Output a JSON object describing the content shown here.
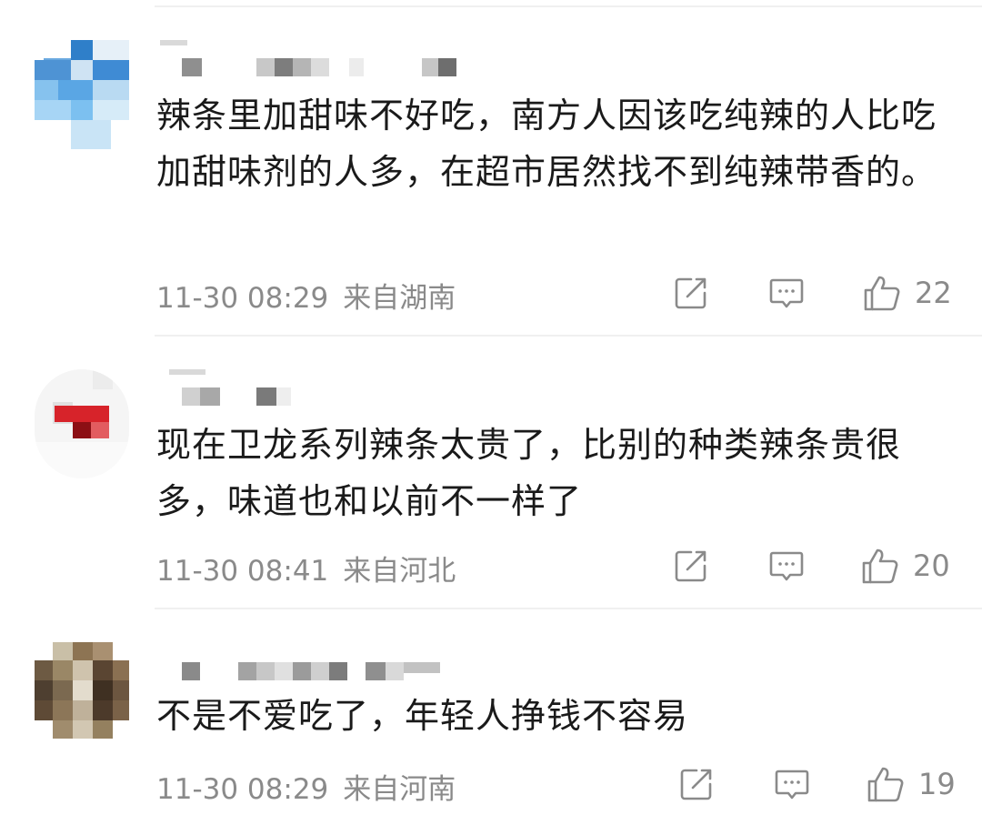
{
  "comments": [
    {
      "text": "辣条里加甜味不好吃，南方人因该吃纯辣的人比吃加甜味剂的人多，在超市居然找不到纯辣带香的。",
      "time": "11-30 08:29",
      "location": "来自湖南",
      "likes": "22",
      "avatar_icon": "avatar-blurred-blue",
      "accent": "#3d8fd6"
    },
    {
      "text": "现在卫龙系列辣条太贵了，比别的种类辣条贵很多，味道也和以前不一样了",
      "time": "11-30 08:41",
      "location": "来自河北",
      "likes": "20",
      "avatar_icon": "avatar-blurred-red",
      "accent": "#d7232a"
    },
    {
      "text": "不是不爱吃了，年轻人挣钱不容易",
      "time": "11-30 08:29",
      "location": "来自河南",
      "likes": "19",
      "avatar_icon": "avatar-blurred-brown",
      "accent": "#6d5a43"
    }
  ],
  "icons": {
    "share": "share-icon",
    "reply": "reply-icon",
    "like": "thumbs-up-icon"
  }
}
